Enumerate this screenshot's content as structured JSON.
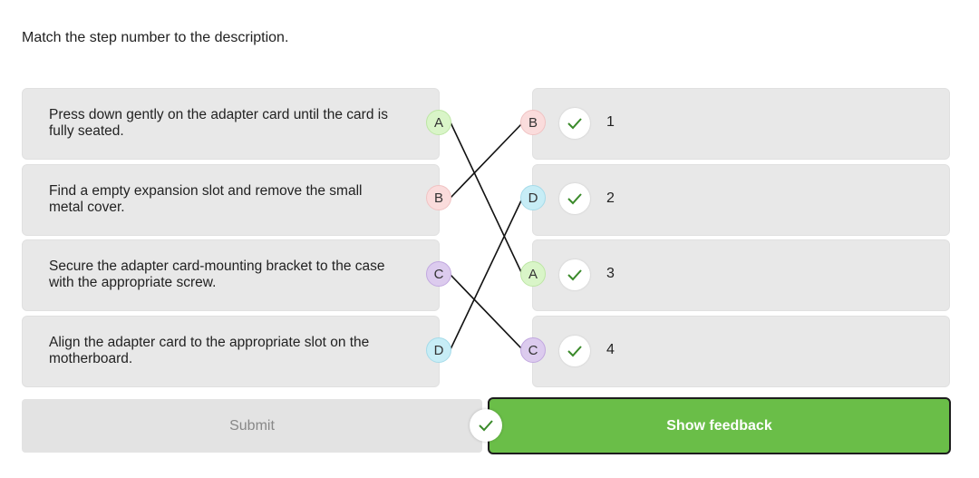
{
  "prompt": "Match the step number to the description.",
  "left_items": [
    {
      "text": "Press down gently on the adapter card until the card is fully seated.",
      "letter": "A"
    },
    {
      "text": "Find a empty expansion slot and remove the small metal cover.",
      "letter": "B"
    },
    {
      "text": "Secure the adapter card-mounting bracket to the case with the appropriate screw.",
      "letter": "C"
    },
    {
      "text": "Align the adapter card to the appropriate slot on the motherboard.",
      "letter": "D"
    }
  ],
  "right_items": [
    {
      "number": "1",
      "letter": "B"
    },
    {
      "number": "2",
      "letter": "D"
    },
    {
      "number": "3",
      "letter": "A"
    },
    {
      "number": "4",
      "letter": "C"
    }
  ],
  "buttons": {
    "submit": "Submit",
    "feedback": "Show feedback"
  },
  "colors": {
    "A": "#d9f5c8",
    "B": "#fadcdc",
    "C": "#dccbee",
    "D": "#c7edf6",
    "check": "#3a8a2a",
    "feedback_button": "#6abe48"
  }
}
